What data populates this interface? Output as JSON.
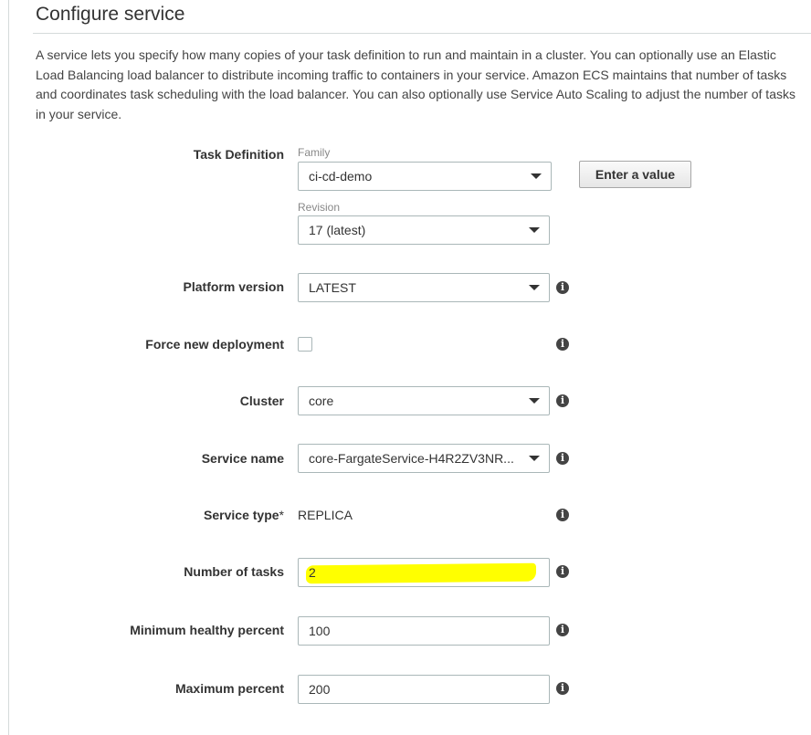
{
  "title": "Configure service",
  "description": "A service lets you specify how many copies of your task definition to run and maintain in a cluster. You can optionally use an Elastic Load Balancing load balancer to distribute incoming traffic to containers in your service. Amazon ECS maintains that number of tasks and coordinates task scheduling with the load balancer. You can also optionally use Service Auto Scaling to adjust the number of tasks in your service.",
  "task_definition": {
    "label": "Task Definition",
    "family_label": "Family",
    "family_value": "ci-cd-demo",
    "revision_label": "Revision",
    "revision_value": "17 (latest)",
    "enter_value_button": "Enter a value"
  },
  "platform_version": {
    "label": "Platform version",
    "value": "LATEST"
  },
  "force_new_deployment": {
    "label": "Force new deployment",
    "checked": false
  },
  "cluster": {
    "label": "Cluster",
    "value": "core"
  },
  "service_name": {
    "label": "Service name",
    "value": "core-FargateService-H4R2ZV3NR..."
  },
  "service_type": {
    "label": "Service type",
    "required_mark": "*",
    "value": "REPLICA"
  },
  "number_of_tasks": {
    "label": "Number of tasks",
    "value": "2",
    "highlight_color": "#ffff00"
  },
  "minimum_healthy_percent": {
    "label": "Minimum healthy percent",
    "value": "100"
  },
  "maximum_percent": {
    "label": "Maximum percent",
    "value": "200"
  },
  "info_icon_glyph": "i"
}
